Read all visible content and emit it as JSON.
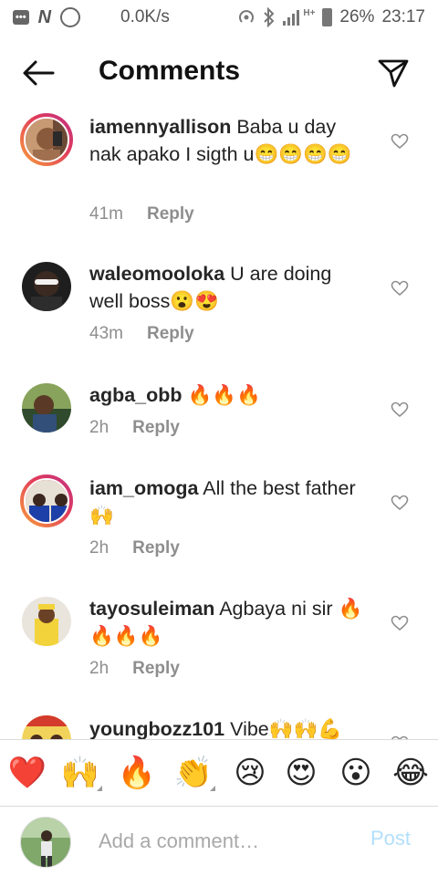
{
  "status_bar": {
    "speed": "0.0K/s",
    "battery": "26%",
    "time": "23:17",
    "network": "H+",
    "icons": [
      "message-icon",
      "n-icon",
      "whatsapp-icon",
      "hotspot-icon",
      "bluetooth-icon",
      "signal-icon",
      "battery-icon"
    ]
  },
  "header": {
    "title": "Comments",
    "back_icon": "arrow-left-icon",
    "send_icon": "paper-plane-icon"
  },
  "comments": [
    {
      "username": "iamennyallison",
      "text": "Baba u day nak apako I sigth u😁😁😁😁",
      "time": "41m",
      "reply": "Reply",
      "story_ring": true
    },
    {
      "username": "waleomooloka",
      "text": "U are doing well boss😮😍",
      "time": "43m",
      "reply": "Reply",
      "story_ring": false
    },
    {
      "username": "agba_obb",
      "text": "🔥🔥🔥",
      "time": "2h",
      "reply": "Reply",
      "story_ring": false
    },
    {
      "username": "iam_omoga",
      "text": "All the best father🙌",
      "time": "2h",
      "reply": "Reply",
      "story_ring": true
    },
    {
      "username": "tayosuleiman",
      "text": "Agbaya ni sir 🔥🔥🔥🔥",
      "time": "2h",
      "reply": "Reply",
      "story_ring": false
    },
    {
      "username": "youngbozz101",
      "text": "Vibe🙌🙌💪",
      "time": "",
      "reply": "",
      "story_ring": false
    }
  ],
  "reactions": [
    "❤️",
    "🙌",
    "🔥",
    "👏",
    "😢",
    "😍",
    "😮",
    "😂"
  ],
  "composer": {
    "placeholder": "Add a comment…",
    "post_label": "Post"
  },
  "colors": {
    "accent": "#b2dffc",
    "heart": "#e8477b",
    "meta": "#8e8e8e",
    "story_ring_start": "#f9a13a",
    "story_ring_end": "#c03384"
  }
}
